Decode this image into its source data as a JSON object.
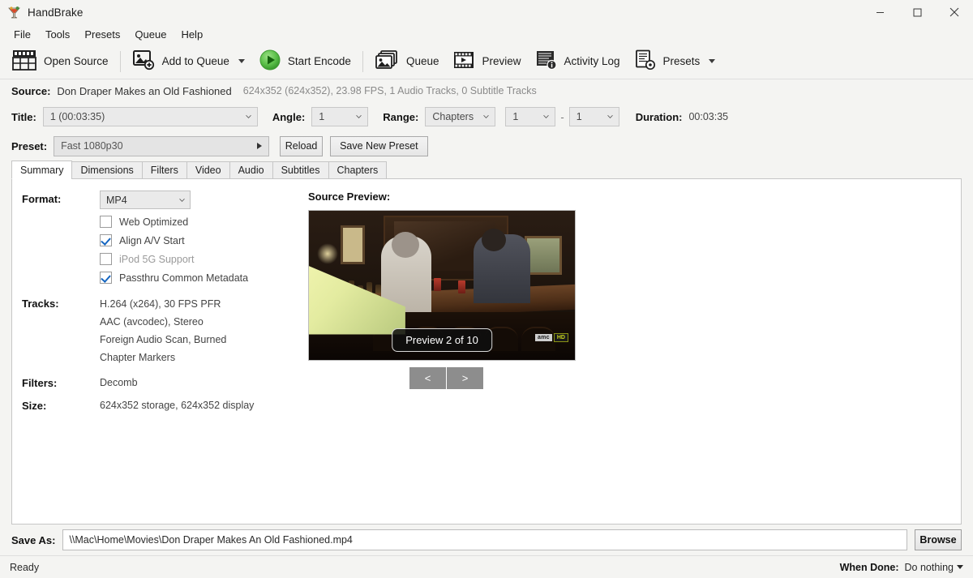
{
  "window": {
    "title": "HandBrake",
    "icon": "handbrake-cocktail-icon",
    "minimize": "minimize-icon",
    "maximize": "maximize-icon",
    "close": "close-icon"
  },
  "menubar": {
    "items": [
      {
        "label": "File"
      },
      {
        "label": "Tools"
      },
      {
        "label": "Presets"
      },
      {
        "label": "Queue"
      },
      {
        "label": "Help"
      }
    ]
  },
  "toolbar": {
    "items": [
      {
        "label": "Open Source",
        "icon": "film-clapper-icon"
      },
      {
        "label": "Add to Queue",
        "icon": "add-to-queue-icon",
        "has_caret": true
      },
      {
        "label": "Start Encode",
        "icon": "green-play-icon"
      },
      {
        "label": "Queue",
        "icon": "queue-stack-icon"
      },
      {
        "label": "Preview",
        "icon": "film-strip-play-icon"
      },
      {
        "label": "Activity Log",
        "icon": "activity-log-icon"
      },
      {
        "label": "Presets",
        "icon": "presets-gear-icon",
        "has_caret": true
      }
    ]
  },
  "source": {
    "label": "Source:",
    "name": "Don Draper Makes an Old Fashioned",
    "meta": "624x352 (624x352), 23.98 FPS, 1 Audio Tracks, 0 Subtitle Tracks"
  },
  "controls": {
    "title_label": "Title:",
    "title_value": "1  (00:03:35)",
    "angle_label": "Angle:",
    "angle_value": "1",
    "range_label": "Range:",
    "range_value": "Chapters",
    "chapter_start": "1",
    "chapter_sep": "-",
    "chapter_end": "1",
    "duration_label": "Duration:",
    "duration_value": "00:03:35"
  },
  "preset": {
    "label": "Preset:",
    "value": "Fast 1080p30",
    "reload_label": "Reload",
    "save_label": "Save New Preset"
  },
  "tabs": [
    {
      "label": "Summary",
      "active": true
    },
    {
      "label": "Dimensions",
      "active": false
    },
    {
      "label": "Filters",
      "active": false
    },
    {
      "label": "Video",
      "active": false
    },
    {
      "label": "Audio",
      "active": false
    },
    {
      "label": "Subtitles",
      "active": false
    },
    {
      "label": "Chapters",
      "active": false
    }
  ],
  "summary": {
    "format_label": "Format:",
    "format_value": "MP4",
    "checkboxes": [
      {
        "label": "Web Optimized",
        "checked": false,
        "disabled": false
      },
      {
        "label": "Align A/V Start",
        "checked": true,
        "disabled": false
      },
      {
        "label": "iPod 5G Support",
        "checked": false,
        "disabled": true
      },
      {
        "label": "Passthru Common Metadata",
        "checked": true,
        "disabled": false
      }
    ],
    "tracks_label": "Tracks:",
    "tracks": [
      "H.264 (x264), 30 FPS PFR",
      "AAC (avcodec), Stereo",
      "Foreign Audio Scan, Burned",
      "Chapter Markers"
    ],
    "filters_label": "Filters:",
    "filters_value": "Decomb",
    "size_label": "Size:",
    "size_value": "624x352 storage, 624x352 display"
  },
  "preview": {
    "title": "Source Preview:",
    "badge": "Preview 2 of 10",
    "prev_label": "<",
    "next_label": ">",
    "watermark_amc": "amc",
    "watermark_hd": "HD"
  },
  "saveas": {
    "label": "Save As:",
    "value": "\\\\Mac\\Home\\Movies\\Don Draper Makes An Old Fashioned.mp4",
    "browse_label": "Browse"
  },
  "statusbar": {
    "status": "Ready",
    "whendone_label": "When Done:",
    "whendone_value": "Do nothing"
  },
  "colors": {
    "accent_check": "#1565c0",
    "play_green": "#4caf50",
    "chrome": "#f4f4f2",
    "panel": "#ffffff"
  }
}
